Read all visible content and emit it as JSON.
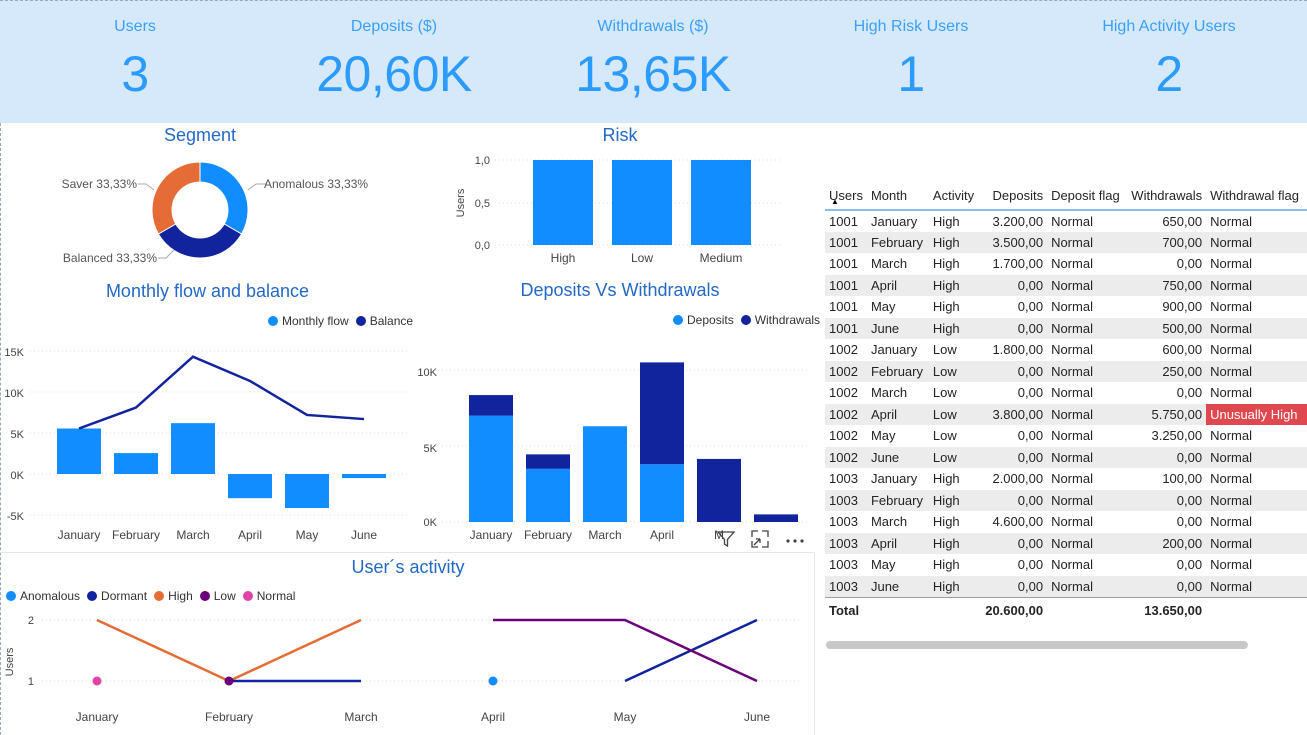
{
  "kpis": [
    {
      "label": "Users",
      "value": "3"
    },
    {
      "label": "Deposits ($)",
      "value": "20,60K"
    },
    {
      "label": "Withdrawals ($)",
      "value": "13,65K"
    },
    {
      "label": "High Risk Users",
      "value": "1"
    },
    {
      "label": "High Activity Users",
      "value": "2"
    }
  ],
  "segment": {
    "title": "Segment",
    "slices": [
      {
        "label": "Anomalous 33,33%",
        "value": 33.33,
        "color": "#118dff"
      },
      {
        "label": "Balanced 33,33%",
        "value": 33.33,
        "color": "#12239e"
      },
      {
        "label": "Saver 33,33%",
        "value": 33.33,
        "color": "#e66c37"
      }
    ]
  },
  "risk": {
    "title": "Risk",
    "ylabel": "Users",
    "yticks": [
      "1,0",
      "0,5",
      "0,0"
    ],
    "categories": [
      "High",
      "Low",
      "Medium"
    ],
    "values": [
      1,
      1,
      1
    ],
    "color": "#118dff"
  },
  "monthly": {
    "title": "Monthly flow and balance",
    "legend": [
      {
        "label": "Monthly flow",
        "color": "#118dff"
      },
      {
        "label": "Balance",
        "color": "#12239e"
      }
    ],
    "yticks": [
      "15K",
      "10K",
      "5K",
      "0K",
      "-5K"
    ],
    "categories": [
      "January",
      "February",
      "March",
      "April",
      "May",
      "June"
    ],
    "flow": [
      5550,
      2550,
      6200,
      -2950,
      -4150,
      -500
    ],
    "balance": [
      5550,
      8100,
      14300,
      11350,
      7200,
      6700
    ]
  },
  "depwd": {
    "title": "Deposits Vs Withdrawals",
    "legend": [
      {
        "label": "Deposits",
        "color": "#118dff"
      },
      {
        "label": "Withdrawals",
        "color": "#12239e"
      }
    ],
    "yticks": [
      "10K",
      "5K",
      "0K"
    ],
    "categories": [
      "January",
      "February",
      "March",
      "April",
      "M"
    ],
    "deposits": [
      7000,
      3500,
      6300,
      3800,
      0,
      0
    ],
    "withdrawals": [
      1350,
      950,
      0,
      6700,
      4150,
      500
    ]
  },
  "activity": {
    "title": "User´s activity",
    "ylabel": "Users",
    "yticks": [
      "2",
      "1"
    ],
    "legend": [
      {
        "label": "Anomalous",
        "color": "#118dff"
      },
      {
        "label": "Dormant",
        "color": "#12239e"
      },
      {
        "label": "High",
        "color": "#e66c37"
      },
      {
        "label": "Low",
        "color": "#6b007b"
      },
      {
        "label": "Normal",
        "color": "#e044a7"
      }
    ],
    "months": [
      "January",
      "February",
      "March",
      "April",
      "May",
      "June"
    ]
  },
  "table": {
    "headers": [
      "Users",
      "Month",
      "Activity",
      "Deposits",
      "Deposit flag",
      "Withdrawals",
      "Withdrawal flag"
    ],
    "rows": [
      [
        "1001",
        "January",
        "High",
        "3.200,00",
        "Normal",
        "650,00",
        "Normal"
      ],
      [
        "1001",
        "February",
        "High",
        "3.500,00",
        "Normal",
        "700,00",
        "Normal"
      ],
      [
        "1001",
        "March",
        "High",
        "1.700,00",
        "Normal",
        "0,00",
        "Normal"
      ],
      [
        "1001",
        "April",
        "High",
        "0,00",
        "Normal",
        "750,00",
        "Normal"
      ],
      [
        "1001",
        "May",
        "High",
        "0,00",
        "Normal",
        "900,00",
        "Normal"
      ],
      [
        "1001",
        "June",
        "High",
        "0,00",
        "Normal",
        "500,00",
        "Normal"
      ],
      [
        "1002",
        "January",
        "Low",
        "1.800,00",
        "Normal",
        "600,00",
        "Normal"
      ],
      [
        "1002",
        "February",
        "Low",
        "0,00",
        "Normal",
        "250,00",
        "Normal"
      ],
      [
        "1002",
        "March",
        "Low",
        "0,00",
        "Normal",
        "0,00",
        "Normal"
      ],
      [
        "1002",
        "April",
        "Low",
        "3.800,00",
        "Normal",
        "5.750,00",
        "Unusually High"
      ],
      [
        "1002",
        "May",
        "Low",
        "0,00",
        "Normal",
        "3.250,00",
        "Normal"
      ],
      [
        "1002",
        "June",
        "Low",
        "0,00",
        "Normal",
        "0,00",
        "Normal"
      ],
      [
        "1003",
        "January",
        "High",
        "2.000,00",
        "Normal",
        "100,00",
        "Normal"
      ],
      [
        "1003",
        "February",
        "High",
        "0,00",
        "Normal",
        "0,00",
        "Normal"
      ],
      [
        "1003",
        "March",
        "High",
        "4.600,00",
        "Normal",
        "0,00",
        "Normal"
      ],
      [
        "1003",
        "April",
        "High",
        "0,00",
        "Normal",
        "200,00",
        "Normal"
      ],
      [
        "1003",
        "May",
        "High",
        "0,00",
        "Normal",
        "0,00",
        "Normal"
      ],
      [
        "1003",
        "June",
        "High",
        "0,00",
        "Normal",
        "0,00",
        "Normal"
      ]
    ],
    "total": {
      "label": "Total",
      "deposits": "20.600,00",
      "withdrawals": "13.650,00"
    }
  },
  "icons": {
    "filter": "filter-icon",
    "focus": "focus-mode-icon",
    "more": "more-options-icon"
  }
}
